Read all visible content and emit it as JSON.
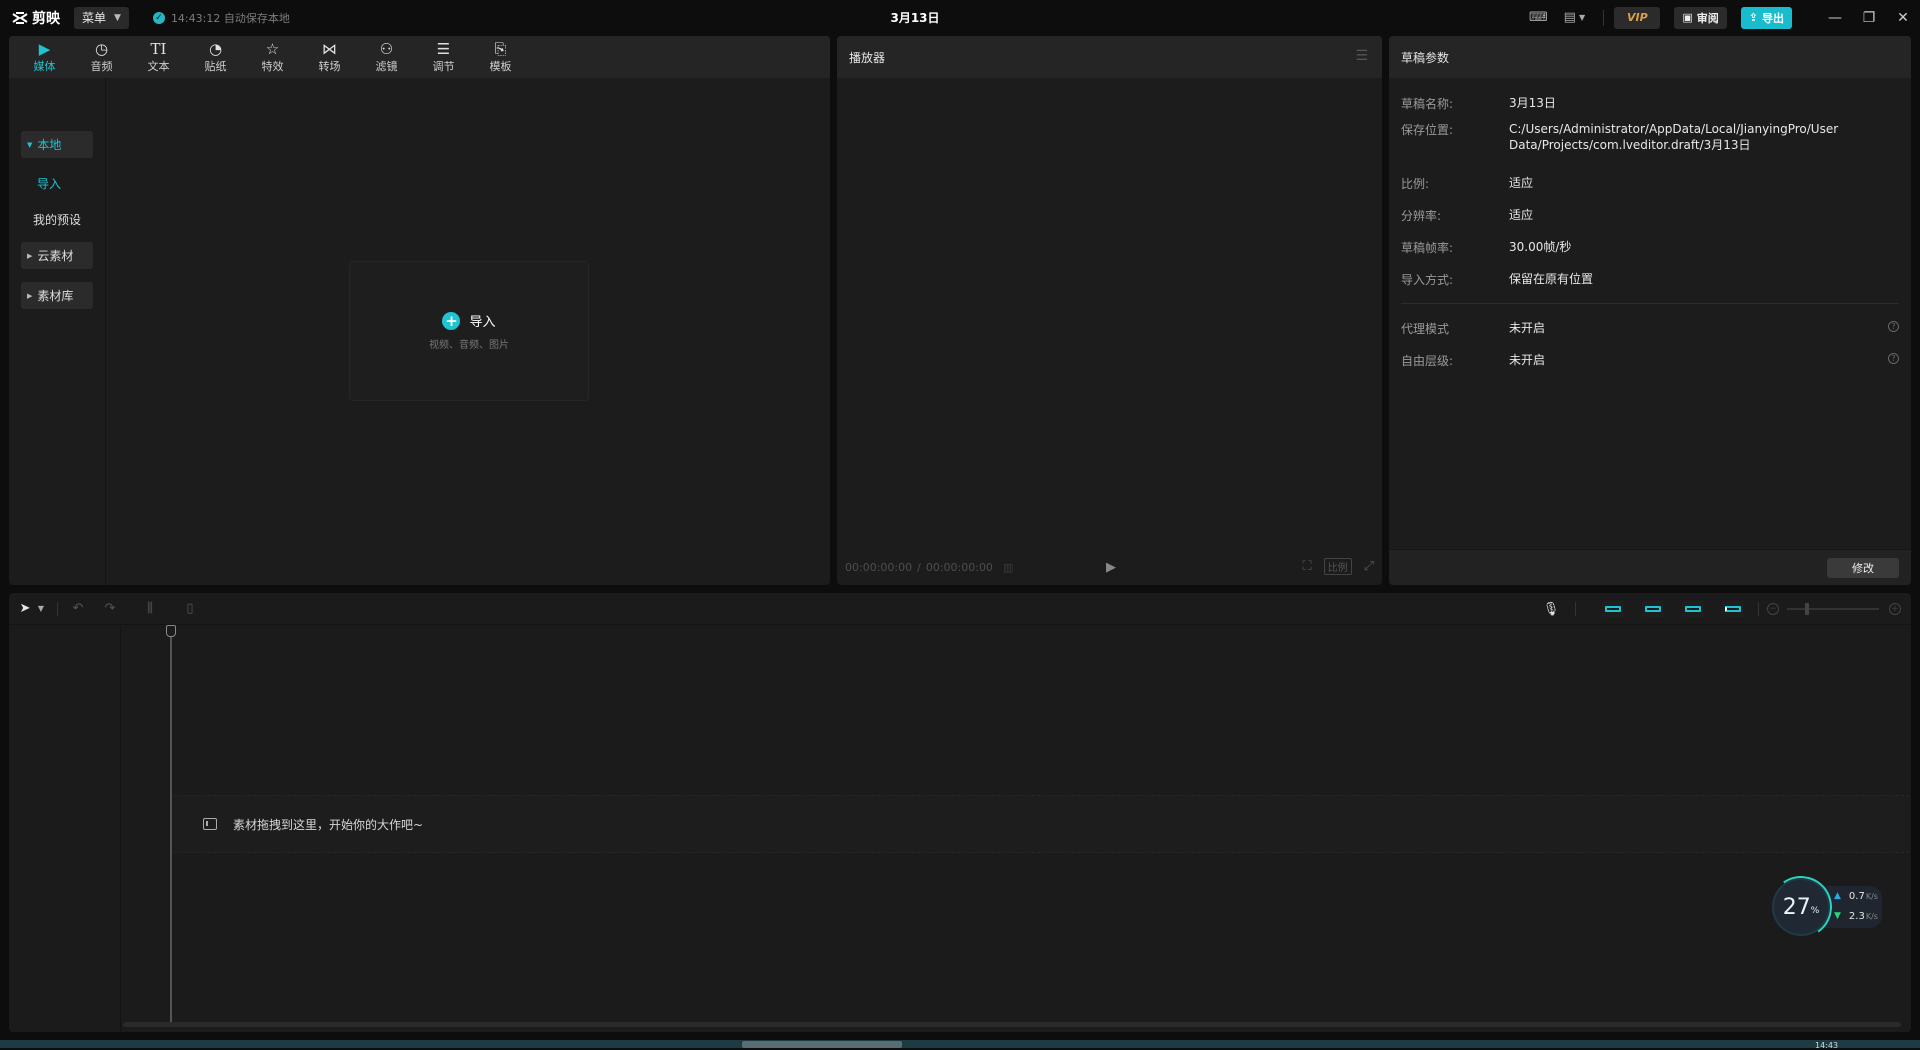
{
  "app": {
    "name": "剪映",
    "menu_label": "菜单",
    "autosave_text": "14:43:12 自动保存本地",
    "title": "3月13日",
    "vip_label": "VIP",
    "review_label": "审阅",
    "export_label": "导出"
  },
  "media_tabs": [
    {
      "label": "媒体",
      "icon": "media-icon",
      "active": true
    },
    {
      "label": "音频",
      "icon": "audio-icon"
    },
    {
      "label": "文本",
      "icon": "text-icon"
    },
    {
      "label": "贴纸",
      "icon": "sticker-icon"
    },
    {
      "label": "特效",
      "icon": "effects-icon"
    },
    {
      "label": "转场",
      "icon": "transition-icon"
    },
    {
      "label": "滤镜",
      "icon": "filter-icon"
    },
    {
      "label": "调节",
      "icon": "adjust-icon"
    },
    {
      "label": "模板",
      "icon": "template-icon"
    }
  ],
  "media_sidebar": {
    "local": "本地",
    "import": "导入",
    "my_presets": "我的预设",
    "cloud": "云素材",
    "library": "素材库"
  },
  "import_box": {
    "label": "导入",
    "hint": "视频、音频、图片"
  },
  "player": {
    "title": "播放器",
    "current_time": "00:00:00:00",
    "total_time": "00:00:00:00",
    "ratio_label": "比例"
  },
  "draft": {
    "title": "草稿参数",
    "rows": [
      {
        "key": "草稿名称:",
        "value": "3月13日"
      },
      {
        "key": "保存位置:",
        "value": "C:/Users/Administrator/AppData/Local/JianyingPro/User Data/Projects/com.lveditor.draft/3月13日"
      },
      {
        "key": "比例:",
        "value": "适应"
      },
      {
        "key": "分辨率:",
        "value": "适应"
      },
      {
        "key": "草稿帧率:",
        "value": "30.00帧/秒"
      },
      {
        "key": "导入方式:",
        "value": "保留在原有位置"
      }
    ],
    "extra_rows": [
      {
        "key": "代理模式",
        "value": "未开启"
      },
      {
        "key": "自由层级:",
        "value": "未开启"
      }
    ],
    "modify_label": "修改"
  },
  "timeline": {
    "drop_hint": "素材拖拽到这里，开始你的大作吧~"
  },
  "net_widget": {
    "percent": "27",
    "percent_unit": "%",
    "upload": "0.7",
    "download": "2.3",
    "unit": "K/s"
  },
  "taskbar": {
    "time": "14:43"
  },
  "colors": {
    "accent": "#20c3d1",
    "background": "#0d0d0d",
    "panel": "#1c1c1c"
  }
}
